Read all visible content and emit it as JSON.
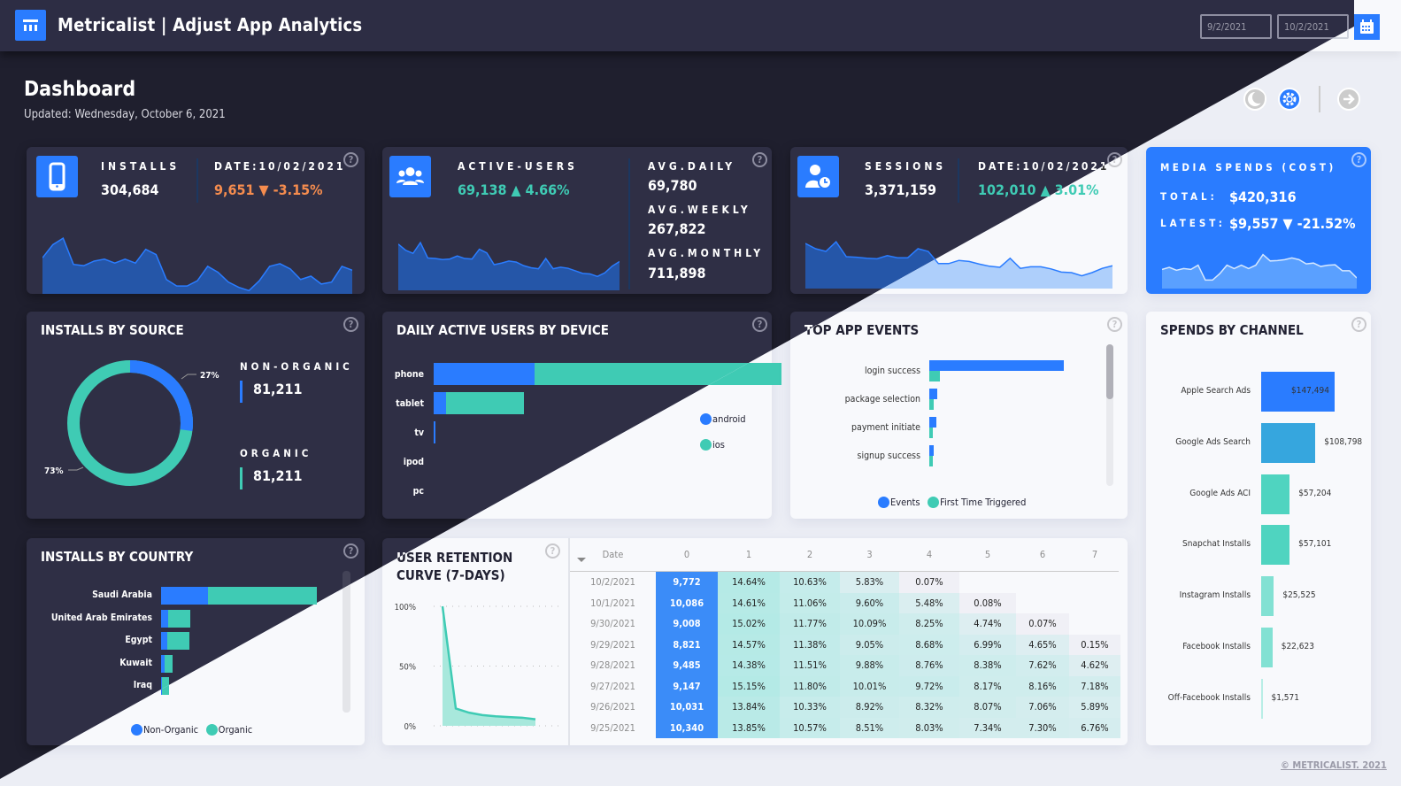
{
  "app": {
    "title": "Metricalist | Adjust App Analytics",
    "page_title": "Dashboard",
    "updated": "Updated: Wednesday, October 6, 2021"
  },
  "date_range": {
    "start": "9/2/2021",
    "end": "10/2/2021"
  },
  "header_buttons": {
    "dark_mode": "moon-icon",
    "settings": "gear-icon",
    "next": "arrow-right-icon"
  },
  "kpi": {
    "installs": {
      "label": "INSTALLS",
      "value": "304,684",
      "date_label": "DATE:10/02/2021",
      "date_value": "9,651 ▼ -3.15%",
      "trend_color": "#f58c4e"
    },
    "active_users": {
      "label": "ACTIVE-USERS",
      "value": "69,138 ▲ 4.66%",
      "trend_color": "#3fcbb4",
      "avg_daily_label": "AVG.DAILY",
      "avg_daily": "69,780",
      "avg_weekly_label": "AVG.WEEKLY",
      "avg_weekly": "267,822",
      "avg_monthly_label": "AVG.MONTHLY",
      "avg_monthly": "711,898"
    },
    "sessions": {
      "label": "SESSIONS",
      "value": "3,371,159",
      "date_label": "DATE:10/02/2021",
      "date_value": "102,010 ▲ 3.01%",
      "trend_color": "#3fcbb4"
    },
    "media_spends": {
      "label": "MEDIA SPENDS (COST)",
      "total_label": "TOTAL:",
      "total": "$420,316",
      "latest_label": "LATEST:",
      "latest": "$9,557 ▼ -21.52%"
    }
  },
  "sparklines": {
    "installs": [
      0.55,
      0.75,
      0.85,
      0.45,
      0.43,
      0.5,
      0.53,
      0.47,
      0.53,
      0.47,
      0.68,
      0.6,
      0.22,
      0.12,
      0.12,
      0.2,
      0.42,
      0.33,
      0.18,
      0.1,
      0.05,
      0.2,
      0.42,
      0.46,
      0.38,
      0.22,
      0.27,
      0.15,
      0.18,
      0.42,
      0.36
    ],
    "active_users": [
      0.9,
      0.78,
      0.72,
      0.93,
      0.63,
      0.62,
      0.6,
      0.61,
      0.67,
      0.62,
      0.61,
      0.8,
      0.73,
      0.5,
      0.53,
      0.57,
      0.55,
      0.48,
      0.44,
      0.42,
      0.62,
      0.42,
      0.45,
      0.43,
      0.38,
      0.33,
      0.32,
      0.27,
      0.34,
      0.47,
      0.56
    ],
    "sessions": [
      0.85,
      0.75,
      0.7,
      0.88,
      0.6,
      0.59,
      0.57,
      0.56,
      0.62,
      0.58,
      0.58,
      0.75,
      0.7,
      0.47,
      0.47,
      0.53,
      0.51,
      0.46,
      0.42,
      0.4,
      0.57,
      0.38,
      0.41,
      0.41,
      0.37,
      0.31,
      0.3,
      0.24,
      0.3,
      0.38,
      0.43
    ],
    "media_spends": [
      0.45,
      0.5,
      0.43,
      0.47,
      0.45,
      0.55,
      0.2,
      0.2,
      0.35,
      0.55,
      0.47,
      0.55,
      0.47,
      0.55,
      0.8,
      0.65,
      0.66,
      0.68,
      0.72,
      0.68,
      0.58,
      0.6,
      0.52,
      0.55,
      0.56,
      0.42,
      0.42,
      0.25
    ]
  },
  "installs_by_source": {
    "title": "INSTALLS BY SOURCE",
    "non_organic_label": "NON-ORGANIC",
    "non_organic_value": "81,211",
    "non_organic_pct": "27%",
    "organic_label": "ORGANIC",
    "organic_value": "81,211",
    "organic_pct": "73%"
  },
  "device_chart": {
    "title": "DAILY ACTIVE USERS BY DEVICE",
    "legend": [
      {
        "name": "android",
        "color": "#2a7cff"
      },
      {
        "name": "ios",
        "color": "#3fcbb4"
      }
    ],
    "rows": [
      {
        "label": "phone",
        "android": 0.29,
        "ios": 0.71
      },
      {
        "label": "tablet",
        "android": 0.035,
        "ios": 0.225
      },
      {
        "label": "tv",
        "android": 0.004,
        "ios": 0
      },
      {
        "label": "ipod",
        "android": 0,
        "ios": 0
      },
      {
        "label": "pc",
        "android": 0,
        "ios": 0
      }
    ]
  },
  "top_events": {
    "title": "TOP APP EVENTS",
    "legend": [
      {
        "name": "Events",
        "color": "#2a7cff"
      },
      {
        "name": "First Time Triggered",
        "color": "#3fcbb4"
      }
    ],
    "rows": [
      {
        "label": "login success",
        "events": 1.0,
        "first": 0.08
      },
      {
        "label": "package selection",
        "events": 0.06,
        "first": 0.03
      },
      {
        "label": "payment initiate",
        "events": 0.055,
        "first": 0.022
      },
      {
        "label": "signup success",
        "events": 0.03,
        "first": 0.028
      }
    ]
  },
  "spends_by_channel": {
    "title": "SPENDS BY CHANNEL",
    "rows": [
      {
        "label": "Apple Search Ads",
        "value": 147494,
        "display": "$147,494",
        "color": "#2a7cff"
      },
      {
        "label": "Google Ads Search",
        "value": 108798,
        "display": "$108,798",
        "color": "#36a6de"
      },
      {
        "label": "Google Ads ACI",
        "value": 57204,
        "display": "$57,204",
        "color": "#4fd4c0"
      },
      {
        "label": "Snapchat Installs",
        "value": 57101,
        "display": "$57,101",
        "color": "#4fd4c0"
      },
      {
        "label": "Instagram Installs",
        "value": 25525,
        "display": "$25,525",
        "color": "#82e1d3"
      },
      {
        "label": "Facebook Installs",
        "value": 22623,
        "display": "$22,623",
        "color": "#82e1d3"
      },
      {
        "label": "Off-Facebook Installs",
        "value": 1571,
        "display": "$1,571",
        "color": "#b8eee6"
      }
    ]
  },
  "country_chart": {
    "title": "INSTALLS BY COUNTRY",
    "legend": [
      {
        "name": "Non-Organic",
        "color": "#2a7cff"
      },
      {
        "name": "Organic",
        "color": "#3fcbb4"
      }
    ],
    "rows": [
      {
        "label": "Saudi Arabia",
        "non_organic": 0.3,
        "organic": 0.7
      },
      {
        "label": "United Arab Emirates",
        "non_organic": 0.045,
        "organic": 0.14
      },
      {
        "label": "Egypt",
        "non_organic": 0.04,
        "organic": 0.14
      },
      {
        "label": "Kuwait",
        "non_organic": 0.02,
        "organic": 0.055
      },
      {
        "label": "Iraq",
        "non_organic": 0.005,
        "organic": 0.048
      }
    ]
  },
  "retention_curve": {
    "title_line1": "USER RETENTION",
    "title_line2": "CURVE (7-DAYS)",
    "y_ticks": [
      "100%",
      "50%",
      "0%"
    ],
    "values": [
      100,
      14.5,
      11,
      9,
      8,
      7.3,
      6.8,
      5.5
    ]
  },
  "retention_table": {
    "columns": [
      "Date",
      "0",
      "1",
      "2",
      "3",
      "4",
      "5",
      "6",
      "7"
    ],
    "rows": [
      [
        "10/2/2021",
        "9,772",
        "14.64%",
        "10.63%",
        "5.83%",
        "0.07%",
        "",
        "",
        ""
      ],
      [
        "10/1/2021",
        "10,086",
        "14.61%",
        "11.06%",
        "9.60%",
        "5.48%",
        "0.08%",
        "",
        ""
      ],
      [
        "9/30/2021",
        "9,008",
        "15.02%",
        "11.77%",
        "10.09%",
        "8.25%",
        "4.74%",
        "0.07%",
        ""
      ],
      [
        "9/29/2021",
        "8,821",
        "14.57%",
        "11.38%",
        "9.05%",
        "8.68%",
        "6.99%",
        "4.65%",
        "0.15%"
      ],
      [
        "9/28/2021",
        "9,485",
        "14.38%",
        "11.51%",
        "9.88%",
        "8.76%",
        "8.38%",
        "7.62%",
        "4.62%"
      ],
      [
        "9/27/2021",
        "9,147",
        "15.15%",
        "11.80%",
        "10.01%",
        "9.72%",
        "8.17%",
        "8.16%",
        "7.18%"
      ],
      [
        "9/26/2021",
        "10,031",
        "13.84%",
        "10.33%",
        "8.92%",
        "8.32%",
        "8.07%",
        "7.06%",
        "5.89%"
      ],
      [
        "9/25/2021",
        "10,340",
        "13.85%",
        "10.57%",
        "8.51%",
        "8.03%",
        "7.34%",
        "7.30%",
        "6.76%"
      ]
    ]
  },
  "footer": "© METRICALIST. 2021",
  "help_glyph": "?"
}
